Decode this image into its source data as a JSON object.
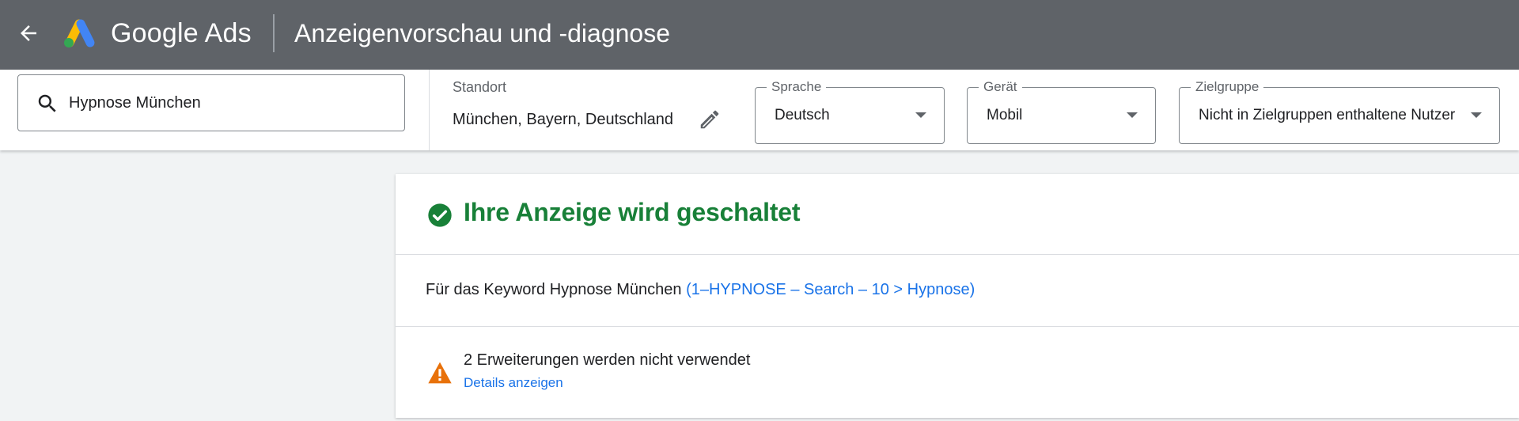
{
  "header": {
    "back_icon": "arrow-left-icon",
    "logo_icon": "google-ads-logo",
    "brand": "Google Ads",
    "title": "Anzeigenvorschau und -diagnose",
    "background": "#5f6368"
  },
  "toolbar": {
    "search": {
      "icon": "search-icon",
      "value": "Hypnose München"
    },
    "location": {
      "label": "Standort",
      "value": "München, Bayern, Deutschland",
      "edit_icon": "pencil-icon"
    },
    "language": {
      "label": "Sprache",
      "value": "Deutsch"
    },
    "device": {
      "label": "Gerät",
      "value": "Mobil"
    },
    "audience": {
      "label": "Zielgruppe",
      "value": "Nicht in Zielgruppen enthaltene Nutzer"
    }
  },
  "card": {
    "status": {
      "icon": "check-circle-icon",
      "text": "Ihre Anzeige wird geschaltet",
      "color": "#188038"
    },
    "keyword": {
      "prefix": "Für das Keyword Hypnose München",
      "link": "(1–HYPNOSE – Search – 10 > Hypnose)",
      "link_color": "#1a73e8"
    },
    "warning": {
      "icon": "warning-triangle-icon",
      "text": "2 Erweiterungen werden nicht verwendet",
      "link": "Details anzeigen",
      "icon_color": "#e8710a"
    }
  }
}
